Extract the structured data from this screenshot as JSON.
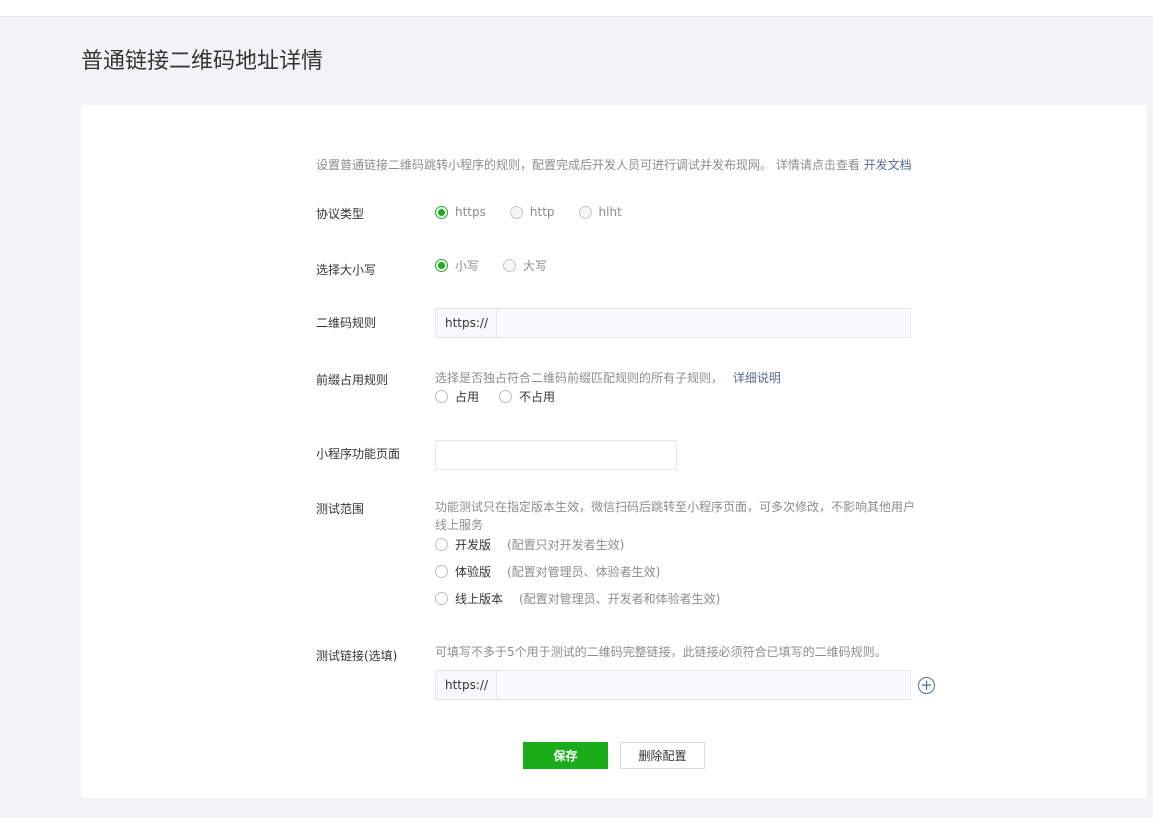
{
  "page": {
    "title": "普通链接二维码地址详情"
  },
  "intro": {
    "text": "设置普通链接二维码跳转小程序的规则，配置完成后开发人员可进行调试并发布现网。 详情请点击查看",
    "link": "开发文档"
  },
  "protocol": {
    "label": "协议类型",
    "options": [
      {
        "label": "https",
        "checked": true
      },
      {
        "label": "http",
        "checked": false
      },
      {
        "label": "hlht",
        "checked": false
      }
    ]
  },
  "case": {
    "label": "选择大小写",
    "options": [
      {
        "label": "小写",
        "checked": true
      },
      {
        "label": "大写",
        "checked": false
      }
    ]
  },
  "rule": {
    "label": "二维码规则",
    "prefix": "https://",
    "value": ""
  },
  "prefix_rule": {
    "label": "前缀占用规则",
    "hint": "选择是否独占符合二维码前缀匹配规则的所有子规则，",
    "hint_link": "详细说明",
    "options": [
      {
        "label": "占用",
        "checked": false
      },
      {
        "label": "不占用",
        "checked": false
      }
    ]
  },
  "page_path": {
    "label": "小程序功能页面",
    "value": ""
  },
  "scope": {
    "label": "测试范围",
    "hint_line1": "功能测试只在指定版本生效，微信扫码后跳转至小程序页面，可多次修改，不影响其他用户",
    "hint_line2": "线上服务",
    "options": [
      {
        "name": "开发版",
        "desc": "(配置只对开发者生效)",
        "checked": false
      },
      {
        "name": "体验版",
        "desc": "(配置对管理员、体验者生效)",
        "checked": false
      },
      {
        "name": "线上版本",
        "desc": "(配置对管理员、开发者和体验者生效)",
        "checked": false
      }
    ]
  },
  "test_link": {
    "label": "测试链接(选填)",
    "hint": "可填写不多于5个用于测试的二维码完整链接，此链接必须符合已填写的二维码规则。",
    "prefix": "https://",
    "value": "",
    "add_icon": "plus-circle-icon"
  },
  "actions": {
    "save": "保存",
    "delete": "删除配置"
  },
  "colors": {
    "accent": "#1aad19",
    "link": "#576b95",
    "background": "#f2f3f5"
  }
}
